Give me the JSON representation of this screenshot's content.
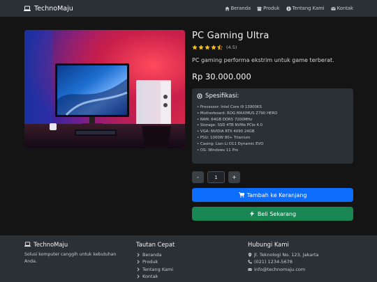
{
  "nav": {
    "brand": "TechnoMaju",
    "links": [
      {
        "label": "Beranda",
        "icon": "home-icon"
      },
      {
        "label": "Produk",
        "icon": "box-icon"
      },
      {
        "label": "Tentang Kami",
        "icon": "info-icon"
      },
      {
        "label": "Kontak",
        "icon": "envelope-icon"
      }
    ]
  },
  "product": {
    "title": "PC Gaming Ultra",
    "rating": 4.5,
    "rating_text": "(4.5)",
    "description": "PC gaming performa ekstrim untuk game terberat.",
    "price": "Rp 30.000.000",
    "image_icon": "gaming-pc-photo"
  },
  "specs": {
    "title": "Spesifikasi:",
    "items": [
      "Processor: Intel Core i9 13900KS",
      "Motherboard: ROG MAXIMUS Z790 HERO",
      "RAM: 64GB DDR5 7200MHz",
      "Storage: SSD 4TB NVMe PCIe 4.0",
      "VGA: NVIDIA RTX 4090 24GB",
      "PSU: 1000W 80+ Titanium",
      "Casing: Lian Li O11 Dynamic EVO",
      "OS: Windows 11 Pro"
    ]
  },
  "quantity": {
    "minus_label": "-",
    "value": "1",
    "plus_label": "+"
  },
  "actions": {
    "cart_label": "Tambah ke Keranjang",
    "buy_label": "Beli Sekarang"
  },
  "footer": {
    "brand": "TechnoMaju",
    "tagline": "Solusi komputer canggih untuk kebutuhan Anda.",
    "quick_links_title": "Tautan Cepat",
    "quick_links": [
      "Beranda",
      "Produk",
      "Tentang Kami",
      "Kontak"
    ],
    "contact_title": "Hubungi Kami",
    "contact": {
      "address": "Jl. Teknologi No. 123, Jakarta",
      "phone": "(021) 1234-5678",
      "email": "info@technomaju.com"
    }
  },
  "colors": {
    "background": "#141414",
    "surface": "#2b3035",
    "primary": "#0d6efd",
    "success": "#198754",
    "star": "#ffc107"
  }
}
